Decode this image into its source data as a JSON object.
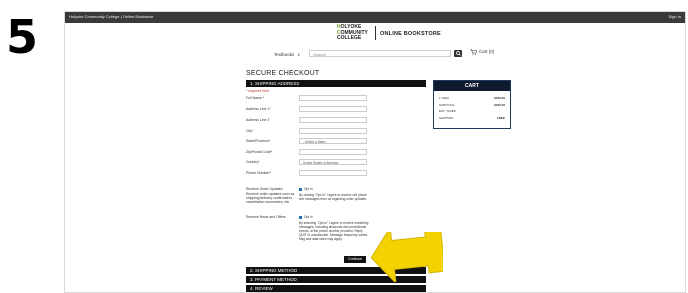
{
  "step_number": "5",
  "topbar": {
    "left_text": "Holyoke Community College | Online Bookstore",
    "right_text": "Sign In"
  },
  "logo": {
    "line1_hl": "H",
    "line1_rest": "OLYOKE",
    "line2_hl": "C",
    "line2_rest": "OMMUNITY",
    "line3": "COLLEGE",
    "store_name": "ONLINE BOOKSTORE"
  },
  "nav": {
    "textbooks_label": "Textbooks",
    "search_placeholder": "Search",
    "cart_label": "Cart (0)"
  },
  "checkout": {
    "title": "SECURE CHECKOUT",
    "shipping_section": "1. SHIPPING ADDRESS",
    "required_note": "* required field",
    "fields": {
      "full_name_label": "Full Name *",
      "address1_label": "Address Line 1*",
      "address2_label": "Address Line 2",
      "city_label": "City*",
      "state_label": "State/Province*",
      "state_value": "--Select a State--",
      "zip_label": "Zip/Postal Code*",
      "country_label": "Country*",
      "country_value": "United States of America",
      "phone_label": "Phone Number*"
    },
    "order_updates": {
      "label": "Receive Order Updates",
      "description": "Receive order updates such as shipping/delivery confirmation, cancellation summaries, etc.",
      "checkbox_label": "Opt in",
      "terms": "By clicking \"Opt-in\" I agree to receive cell phone text messages from us regarding order updates."
    },
    "news_offers": {
      "label": "Receive News and Offers",
      "checkbox_label": "Opt in",
      "terms": "By selecting \"Opt-in\" I agree to receive marketing messages, including discounts and promotional events, at the phone number provided. Reply QUIT to unsubscribe. Message frequency varies. Msg and data rates may apply."
    },
    "continue_label": "Continue",
    "steps": [
      "2. SHIPPING METHOD",
      "3. PAYMENT METHOD",
      "4. REVIEW"
    ]
  },
  "cart": {
    "title": "CART",
    "rows": [
      {
        "label": "1 ITEM",
        "value": "$469.99"
      },
      {
        "label": "SUBTOTAL",
        "value": "$469.99"
      },
      {
        "label": "EST. TAXES",
        "value": ""
      },
      {
        "label": "SHIPPING",
        "value": "FREE"
      }
    ]
  },
  "colors": {
    "bar": "#111111",
    "cart_header": "#0e1b2e",
    "arrow": "#f2d200",
    "accent_green": "#6b9a1f"
  },
  "icons": [
    "search-icon",
    "cart-icon",
    "chevron-down-icon",
    "arrow-pointer-icon"
  ]
}
